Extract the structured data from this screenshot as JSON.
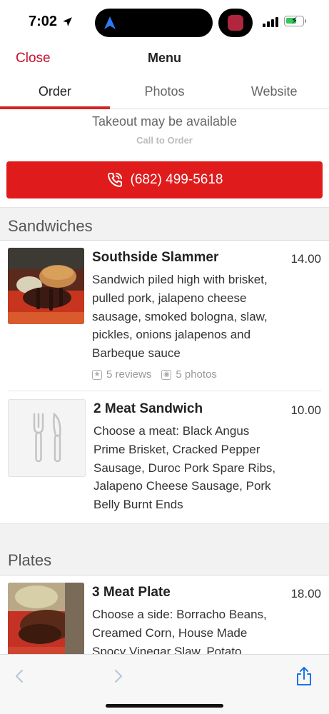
{
  "status_bar": {
    "time": "7:02"
  },
  "header": {
    "close_label": "Close",
    "title": "Menu"
  },
  "tabs": [
    {
      "label": "Order",
      "active": true
    },
    {
      "label": "Photos",
      "active": false
    },
    {
      "label": "Website",
      "active": false
    }
  ],
  "takeout": {
    "title": "Takeout may be available",
    "subtitle": "Call to Order"
  },
  "call_button": {
    "phone": "(682) 499-5618",
    "icon": "phone-icon",
    "color": "#e01b1b"
  },
  "sections": [
    {
      "title": "Sandwiches",
      "items": [
        {
          "name": "Southside Slammer",
          "price": "14.00",
          "description": "Sandwich piled high with brisket, pulled pork, jalapeno cheese sausage, smoked bologna, slaw, pickles, onions jalapenos and Barbeque sauce",
          "reviews": "5 reviews",
          "photos": "5 photos"
        },
        {
          "name": "2 Meat Sandwich",
          "price": "10.00",
          "description": "Choose a meat: Black Angus Prime Brisket, Cracked Pepper Sausage, Duroc Pork Spare Ribs, Jalapeno Cheese Sausage, Pork Belly Burnt Ends"
        }
      ]
    },
    {
      "title": "Plates",
      "items": [
        {
          "name": "3 Meat Plate",
          "price": "18.00",
          "description": "Choose a side: Borracho Beans, Creamed Corn, House Made Spocy Vinegar Slaw, Potato"
        }
      ]
    }
  ],
  "accent_color": "#d32323"
}
